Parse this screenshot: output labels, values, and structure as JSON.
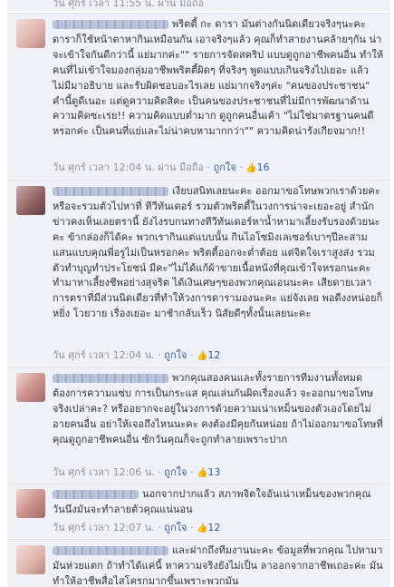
{
  "comments": [
    {
      "text": "",
      "meta_prefix": "วัน ศุกร์ เวลา 11:55 น. ผ่าน มือถือ",
      "reply_label": "",
      "like_count": ""
    },
    {
      "text": "พริตตี้ กะ ดารา มันต่างกันนิดเดียวจริงๆนะคะ ดาราก็ใช้หน้าตาหากินเหมือนกัน เอาจริงๆแล้ว คุณก็ทำสายงานคล้ายๆกัน น่าจะเข้าใจกันดีกว่านี้ แย่มากค่ะ\"\" รายการจัดสคริป แบบดูถูกอาชีพคนอื่น ทำให้คนที่ไม่เข้าใจมองกลุ่มอาชีพพริตตี้ผิดๆ ที่จริงๆ พูดแบบเกินจริงไปเยอะ แล้วไม่มีมาอธิบาย และรับผิดชอบอะไรเลย แย่มากจริงๆค่ะ \"คนของประชาชน\" คำนี้ดูดีเนอะ แต่ดูความคิดสิคะ เป็นคนของประชาชนที่ไม่มีการพัฒนาด้านความคิดซะเรย!! ความคิดแบบต่ำมาก ดูถูกคนอื่นเค้า \"ไม่ใช่มาตรฐานคนดีหรอกค่ะ เป็นคนที่แย่และไม่น่าคบหามากกว่า\"\" ความคิดน่ารังเกียจมาก!!",
      "meta_prefix": "วัน ศุกร์ เวลา 12:04 น. ผ่าน มือถือ ·",
      "reply_label": "ถูกใจ",
      "like_count": "16"
    },
    {
      "text": "เงียบสนิทเลยนะคะ ออกมาขอโทษพวกเราด้วยคะ หรือจะรวมตัวไปหาที่ ทีวีทันเดอร์ รวมตัวพริตตี้ในวงการน่าจะเยอะอยู่ สำนักข่าวคงเห็นเลยตรานี้ ยังไงรบกนทางทีวีทันเดอร์หาน้ำหามาเลี้ยงรับรองด้วยนะคะ ข้ากล่องก็ได้คะ พวกเรากินแต่แบบนั้น กินไอโซมิงเลเซอร์เบาๆปีละสามแสนแบบคุณพี่อรูไม่เป็นหรอกคะ พริตตี้ออกจะต่ำต้อย แต่จิตใจเราสูงส่ง รวมตัวทำบุญทำประโยชน์ มีคะ\"ไม่ได้แก้ผ้าขายเนื้อหนังที่คุณเข้าใจหรอกนะคะ ทำมาหาเลี้ยงชีพอย่างสุจริต ได้เงินเศษๆของพวกคุณเอนนะคะ เสียดายเวลาการตราที่มีส่วนนิดเดียวที่ทำให้วงการดารามองนะคะ แย่จังเลย พอดีงงหน่อยก็หยิ่ง โวยวาย เรื่องเยอะ มาช้ากลับเร็ว นิสัยดีๆทั้งนั้นเลยนะคะ",
      "meta_prefix": "วัน ศุกร์ เวลา 12:04 น. ·",
      "reply_label": "ถูกใจ",
      "like_count": "12"
    },
    {
      "text": "พวกคุณสองคนและทั้งรายการทีมงานทั้งหมด ต้องการความแซ่บ การเป็นกระแส คุณเล่นกันผิดเรื่องแล้ว จะออกมาขอโทษจริงเปล่าคะ? หรืออยากจะอยู่ในวงการด้วยความเน่าเหม็นของตัวเองโดยไม่อายคนอื่น อย่าให้เจอถึงไหนนะคะ คงต้องมีคุยกันหน่อย ถ้าไม่ออกมาขอโทษที่คุณดูถูกอาชีพคนอื่น ซักวันคุณก็จะถูกทำลายเพราะปาก",
      "meta_prefix": "วัน ศุกร์ เวลา 12:06 น. ·",
      "reply_label": "ถูกใจ",
      "like_count": "13"
    },
    {
      "text": "นอกจากปากแล้ว สภาพจิตใจอันเน่าเหม็นของพวกคุณ วันนึงมันจะทำลายตัวคุณแน่นอน",
      "meta_prefix": "วัน ศุกร์ เวลา 12:07 น. ·",
      "reply_label": "ถูกใจ",
      "like_count": "12"
    },
    {
      "text": "และฝากถึงทีมงานนะคะ ข้อมูลที่พวกคุณ ไปหามา มันห่วยแตก ถ้าทำได้แค่นี้ หาความจริงยังไม่เป็น ลาออกจากอาชีพเถอะค่ะ มันทำให้อาชีพสื่อไสโครกมากขึ้นเพราะพวกมัน",
      "meta_prefix": "",
      "reply_label": "",
      "like_count": ""
    }
  ],
  "colors": {
    "comment_bg": "#eef1f7",
    "link": "#3b5998",
    "meta": "#8f9398"
  },
  "icons": {
    "like": "thumbs-up-icon"
  }
}
